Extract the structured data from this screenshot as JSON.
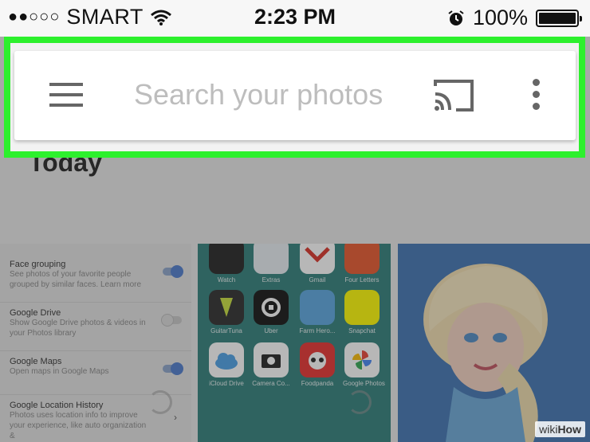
{
  "status_bar": {
    "signal": "●●○○○",
    "carrier": "SMART",
    "time": "2:23 PM",
    "battery": "100%",
    "icons": [
      "wifi-icon",
      "alarm-icon",
      "battery-icon"
    ]
  },
  "search_bar": {
    "placeholder": "Search your photos",
    "icons": [
      "menu-icon",
      "cast-icon",
      "more-vertical-icon"
    ],
    "highlight_color": "#2df02d"
  },
  "section": {
    "title": "Today"
  },
  "settings": [
    {
      "title": "Face grouping",
      "description": "See photos of your favorite people grouped by similar faces. Learn more",
      "toggle": true
    },
    {
      "title": "Google Drive",
      "description": "Show Google Drive photos & videos in your Photos library",
      "toggle": false
    },
    {
      "title": "Google Maps",
      "description": "Open maps in Google Maps",
      "toggle": true
    },
    {
      "title": "Google Location History",
      "description": "Photos uses location info to improve your experience, like auto organization &",
      "toggle": null
    }
  ],
  "home_apps": [
    {
      "label": "Watch",
      "color": "#222222"
    },
    {
      "label": "Extras",
      "color": "#ffffff"
    },
    {
      "label": "Gmail",
      "color": "#ffffff"
    },
    {
      "label": "Four Letters",
      "color": "#e8562b"
    },
    {
      "label": "GuitarTuna",
      "color": "#2b2b2b"
    },
    {
      "label": "Uber",
      "color": "#111111"
    },
    {
      "label": "Farm Hero...",
      "color": "#5aa6e0"
    },
    {
      "label": "Snapchat",
      "color": "#fffc00"
    },
    {
      "label": "iCloud Drive",
      "color": "#ffffff"
    },
    {
      "label": "Camera Co...",
      "color": "#ffffff"
    },
    {
      "label": "Foodpanda",
      "color": "#e8312e"
    },
    {
      "label": "Google Photos",
      "color": "#ffffff"
    }
  ],
  "watermark": {
    "prefix": "wiki",
    "suffix": "How"
  }
}
